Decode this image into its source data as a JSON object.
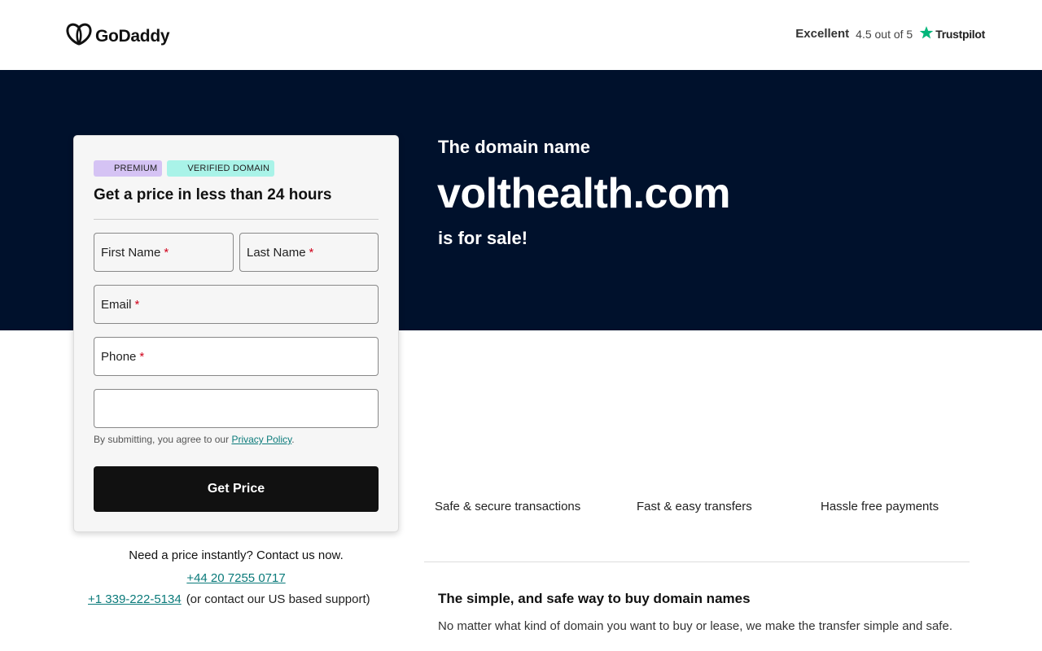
{
  "header": {
    "logo_text": "GoDaddy",
    "rating_label": "Excellent",
    "rating_score": "4.5 out of 5",
    "trustpilot_label": "Trustpilot"
  },
  "hero": {
    "pre": "The domain name",
    "domain": "volthealth.com",
    "post": "is for sale!"
  },
  "form": {
    "badges": [
      "PREMIUM",
      "VERIFIED DOMAIN"
    ],
    "title": "Get a price in less than 24 hours",
    "first_name": "First Name",
    "last_name": "Last Name",
    "email": "Email",
    "phone": "Phone",
    "required_mark": "*",
    "extra_field_value": "",
    "consent_text": "By submitting, you agree to our",
    "privacy_link": "Privacy Policy",
    "consent_end": ".",
    "submit_label": "Get Price"
  },
  "contact": {
    "prompt": "Need a price instantly? Contact us now.",
    "phone_uk": "+44 20 7255 0717",
    "phone_us": "+1 339-222-5134",
    "us_note": "(or contact our US based support)"
  },
  "features": [
    "Safe & secure transactions",
    "Fast & easy transfers",
    "Hassle free payments"
  ],
  "info": {
    "title": "The simple, and safe way to buy domain names",
    "body": "No matter what kind of domain you want to buy or lease, we make the transfer simple and safe."
  },
  "colors": {
    "hero_bg": "#00112c",
    "premium_badge": "#d5c3f4",
    "verified_badge": "#a9f3e8",
    "link": "#0a7a7a",
    "trustpilot_star": "#00b67a",
    "required": "#d0021b"
  },
  "icons": {
    "logo": "godaddy-heart-logo-icon",
    "trustpilot": "star-icon"
  }
}
